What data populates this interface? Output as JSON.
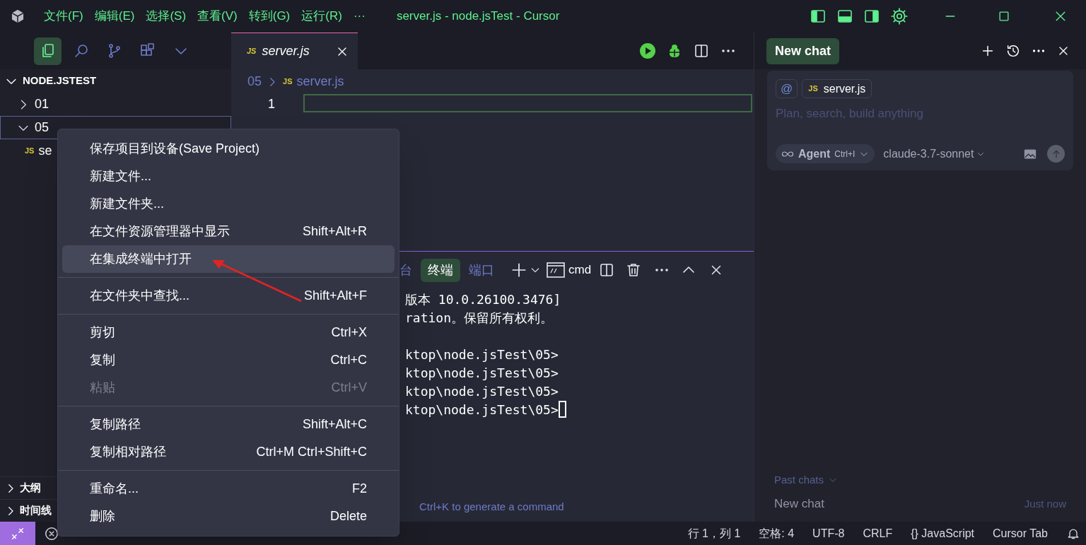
{
  "window": {
    "title": "server.js - node.jsTest - Cursor"
  },
  "menu_bar": [
    "文件(F)",
    "编辑(E)",
    "选择(S)",
    "查看(V)",
    "转到(G)",
    "运行(R)",
    "···"
  ],
  "activity_bar": [
    {
      "kind": "files",
      "selected": true
    },
    {
      "kind": "search",
      "selected": false
    },
    {
      "kind": "source-control",
      "selected": false
    },
    {
      "kind": "extensions",
      "selected": false
    },
    {
      "kind": "more",
      "selected": false
    }
  ],
  "explorer": {
    "title": "NODE.JSTEST",
    "expanded": true,
    "tree": [
      {
        "label": "01",
        "kind": "folder",
        "expanded": false,
        "selected": false
      },
      {
        "label": "05",
        "kind": "folder",
        "expanded": true,
        "selected": true,
        "children": [
          {
            "label": "se",
            "kind": "file",
            "badge": "JS",
            "selected": false
          }
        ]
      }
    ]
  },
  "bottom_sections": [
    {
      "label": "大纲",
      "expanded": false
    },
    {
      "label": "时间线",
      "expanded": false
    }
  ],
  "editor": {
    "tabs": [
      {
        "label": "server.js",
        "badge": "JS",
        "selected": true
      }
    ],
    "breadcrumb": [
      {
        "label": "05"
      },
      {
        "label": "server.js",
        "badge": "JS"
      }
    ],
    "line_numbers": [
      "1"
    ]
  },
  "panel": {
    "tabs": [
      {
        "label": "台",
        "selected": false
      },
      {
        "label": "终端",
        "selected": true
      },
      {
        "label": "端口",
        "selected": false
      }
    ],
    "shell": "cmd",
    "terminal_lines": [
      {
        "text": "版本 10.0.26100.3476]"
      },
      {
        "text": "ration。保留所有权利。"
      },
      {
        "text": "ktop\\node.jsTest\\05>",
        "gap_before": true
      },
      {
        "text": "ktop\\node.jsTest\\05>"
      },
      {
        "text": "ktop\\node.jsTest\\05>"
      },
      {
        "text": "ktop\\node.jsTest\\05>",
        "cursor": true
      }
    ],
    "hint": "Ctrl+K to generate a command"
  },
  "context_menu": [
    {
      "kind": "item",
      "label": "保存项目到设备(Save Project)",
      "selected": false,
      "disabled": false
    },
    {
      "kind": "item",
      "label": "新建文件...",
      "selected": false,
      "disabled": false
    },
    {
      "kind": "item",
      "label": "新建文件夹...",
      "selected": false,
      "disabled": false
    },
    {
      "kind": "item",
      "label": "在文件资源管理器中显示",
      "shortcut": "Shift+Alt+R",
      "selected": false,
      "disabled": false
    },
    {
      "kind": "item",
      "label": "在集成终端中打开",
      "selected": true,
      "disabled": false
    },
    {
      "kind": "separator"
    },
    {
      "kind": "item",
      "label": "在文件夹中查找...",
      "shortcut": "Shift+Alt+F",
      "selected": false,
      "disabled": false
    },
    {
      "kind": "separator"
    },
    {
      "kind": "item",
      "label": "剪切",
      "shortcut": "Ctrl+X",
      "selected": false,
      "disabled": false
    },
    {
      "kind": "item",
      "label": "复制",
      "shortcut": "Ctrl+C",
      "selected": false,
      "disabled": false
    },
    {
      "kind": "item",
      "label": "粘贴",
      "shortcut": "Ctrl+V",
      "selected": false,
      "disabled": true
    },
    {
      "kind": "separator"
    },
    {
      "kind": "item",
      "label": "复制路径",
      "shortcut": "Shift+Alt+C",
      "selected": false,
      "disabled": false
    },
    {
      "kind": "item",
      "label": "复制相对路径",
      "shortcut": "Ctrl+M Ctrl+Shift+C",
      "selected": false,
      "disabled": false
    },
    {
      "kind": "separator"
    },
    {
      "kind": "item",
      "label": "重命名...",
      "shortcut": "F2",
      "selected": false,
      "disabled": false
    },
    {
      "kind": "item",
      "label": "删除",
      "shortcut": "Delete",
      "selected": false,
      "disabled": false
    }
  ],
  "chat": {
    "new_chat_button": "New chat",
    "chips": [
      {
        "kind": "mention",
        "label": "@"
      },
      {
        "kind": "file",
        "label": "server.js",
        "badge": "JS"
      }
    ],
    "placeholder": "Plan, search, build anything",
    "mode": "Agent",
    "mode_shortcut": "Ctrl+I",
    "model": "claude-3.7-sonnet",
    "past_chats_label": "Past chats",
    "history": [
      {
        "title": "New chat",
        "time": "Just now"
      }
    ]
  },
  "status_bar": [
    "行 1，列 1",
    "空格: 4",
    "UTF-8",
    "CRLF",
    "{} JavaScript",
    "Cursor Tab"
  ]
}
